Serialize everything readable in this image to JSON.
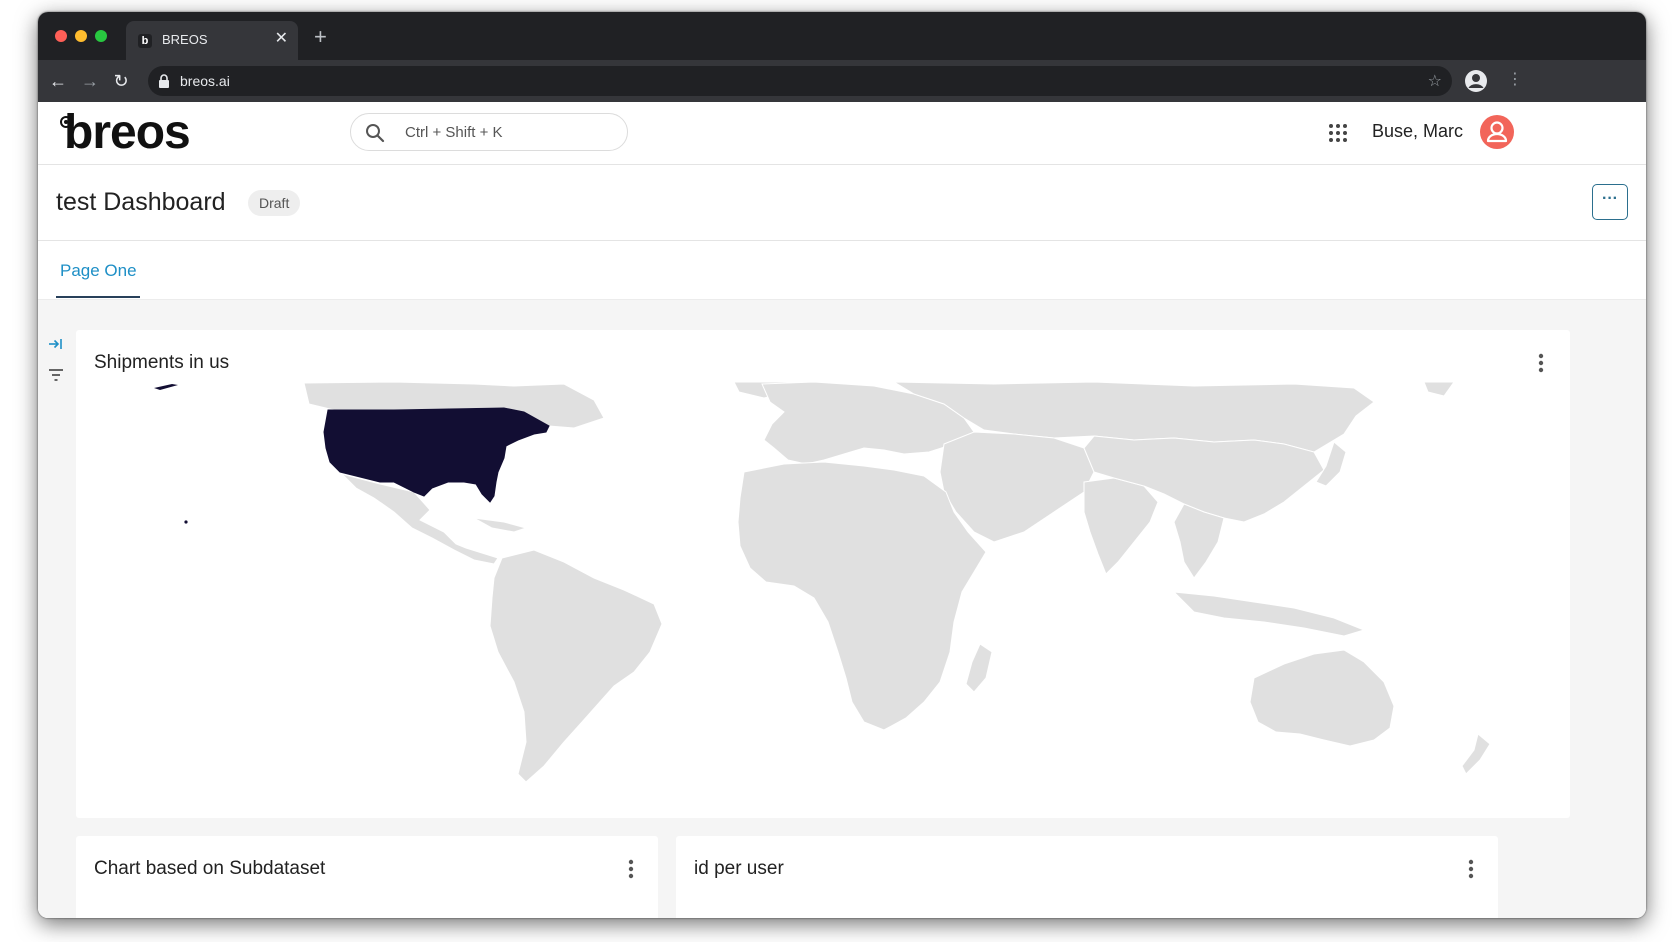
{
  "browser": {
    "tab_title": "BREOS",
    "tab_favicon_letter": "b",
    "url": "breos.ai"
  },
  "header": {
    "logo_text": "breos",
    "search_placeholder": "Ctrl + Shift + K",
    "user_name": "Buse, Marc"
  },
  "dashboard": {
    "title": "test Dashboard",
    "status_badge": "Draft",
    "more_label": "···",
    "tabs": [
      {
        "label": "Page One",
        "active": true
      }
    ]
  },
  "cards": [
    {
      "title": "Shipments in us"
    },
    {
      "title": "Chart based on Subdataset"
    },
    {
      "title": "id per user"
    }
  ],
  "map": {
    "highlighted_country": "United States",
    "highlight_color": "#120e33",
    "base_color": "#e0e0e0"
  }
}
